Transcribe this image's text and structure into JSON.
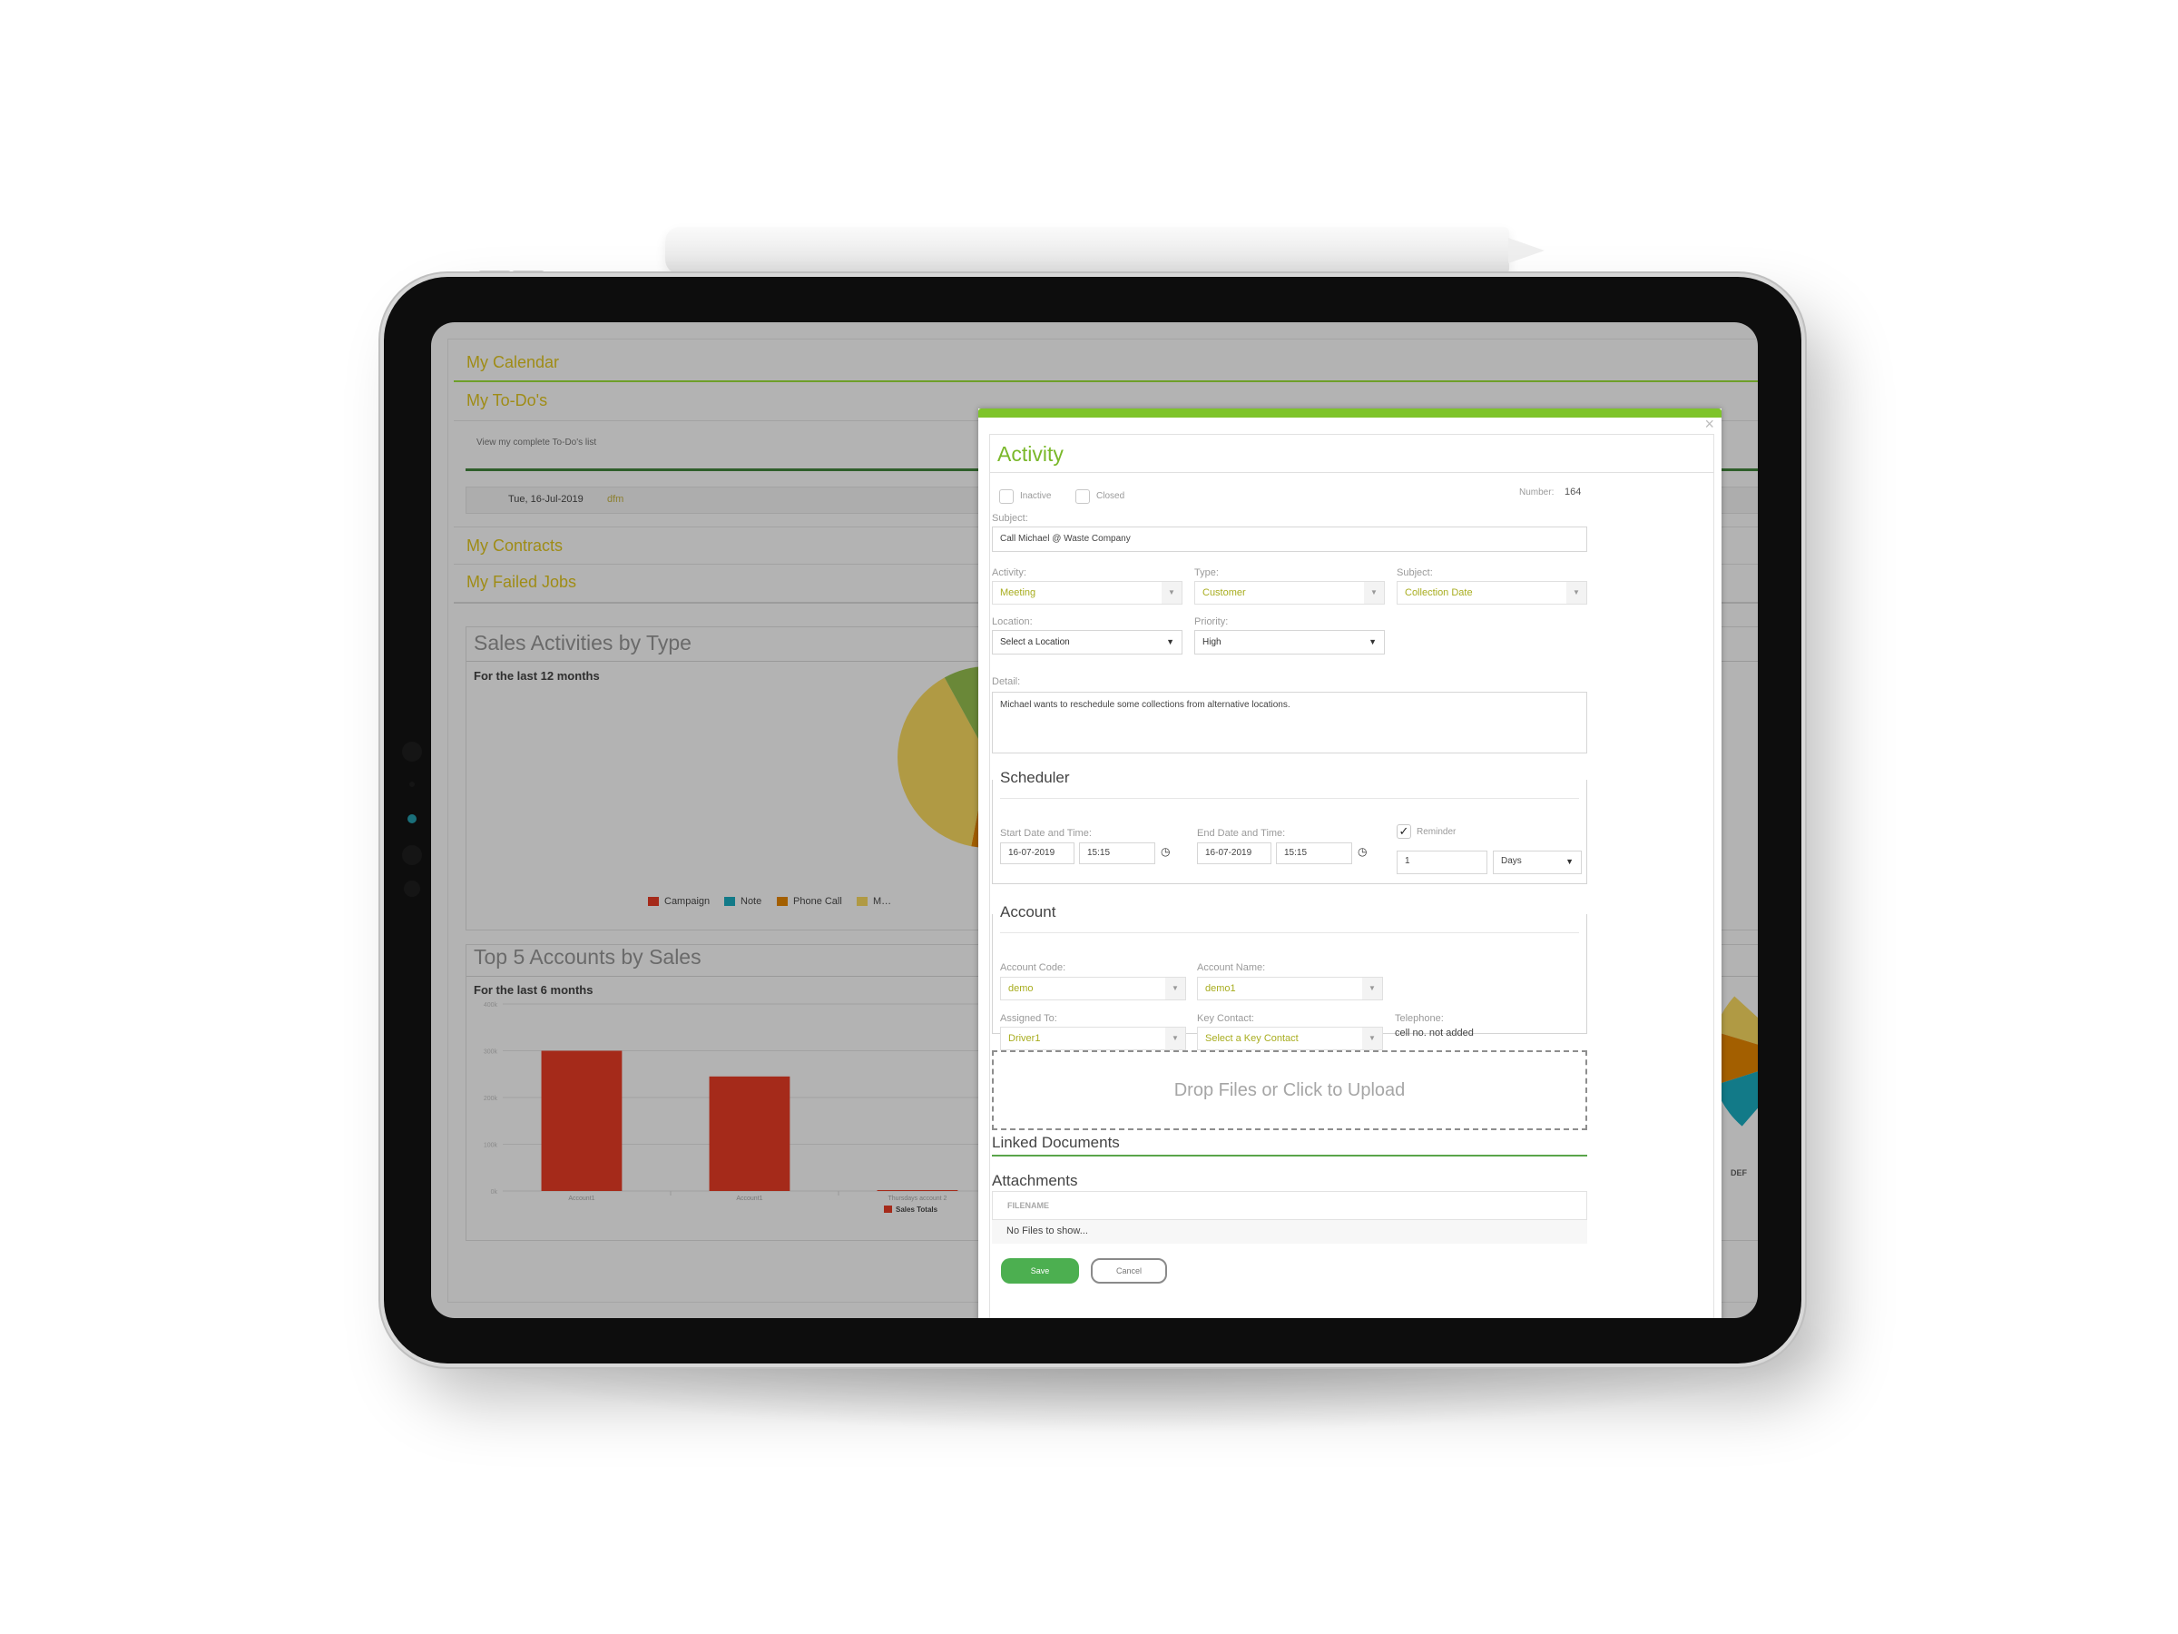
{
  "dashboard": {
    "panels": [
      {
        "title": "My Calendar"
      },
      {
        "title": "My To-Do's"
      },
      {
        "title": "My Contracts"
      },
      {
        "title": "My Failed Jobs"
      }
    ],
    "todo_link": "View my complete To-Do's list",
    "todo_row": {
      "date": "Tue, 16-Jul-2019",
      "user": "dfm"
    },
    "partial_legend_label": "DEF"
  },
  "chart_data": [
    {
      "type": "pie",
      "title": "Sales Activities by Type",
      "subtitle": "For the last 12 months",
      "slices": [
        {
          "label": "Campaign",
          "value": 16,
          "color": "#a52a1a"
        },
        {
          "label": "Note",
          "value": 3,
          "color": "#127a88"
        },
        {
          "label": "Phone Call",
          "value": 34,
          "color": "#a35f00"
        },
        {
          "label": "M…",
          "value": 39,
          "color": "#b09a44"
        },
        {
          "label": "",
          "value": 8,
          "color": "#6a8838"
        }
      ],
      "legend": [
        "Campaign",
        "Note",
        "Phone Call",
        "M…"
      ],
      "legend_position": "bottom"
    },
    {
      "type": "bar",
      "title": "Top 5 Accounts by Sales",
      "subtitle": "For the last 6 months",
      "categories": [
        "Account1",
        "Account1",
        "Thursdays account 2"
      ],
      "series": [
        {
          "name": "Sales Totals",
          "values": [
            300000,
            245000,
            2000
          ],
          "color": "#a52a1a"
        }
      ],
      "yticks": [
        "0k",
        "100k",
        "200k",
        "300k",
        "400k"
      ],
      "ylim": [
        0,
        400000
      ],
      "grid": true,
      "legend_position": "bottom-right"
    }
  ],
  "modal": {
    "title": "Activity",
    "close_icon": "×",
    "inactive_label": "Inactive",
    "closed_label": "Closed",
    "inactive_checked": false,
    "closed_checked": false,
    "number_label": "Number:",
    "number_value": "164",
    "subject_label": "Subject:",
    "subject_value": "Call Michael @ Waste Company",
    "activity_label": "Activity:",
    "activity_value": "Meeting",
    "type_label": "Type:",
    "type_value": "Customer",
    "subject2_label": "Subject:",
    "subject2_value": "Collection Date",
    "location_label": "Location:",
    "location_value": "Select a Location",
    "priority_label": "Priority:",
    "priority_value": "High",
    "detail_label": "Detail:",
    "detail_value": "Michael wants to reschedule some collections from alternative locations.",
    "scheduler": {
      "legend": "Scheduler",
      "start_label": "Start Date and Time:",
      "start_date": "16-07-2019",
      "start_time": "15:15",
      "end_label": "End Date and Time:",
      "end_date": "16-07-2019",
      "end_time": "15:15",
      "reminder_label": "Reminder",
      "reminder_checked": true,
      "reminder_value": "1",
      "reminder_unit": "Days"
    },
    "account": {
      "legend": "Account",
      "code_label": "Account Code:",
      "code_value": "demo",
      "name_label": "Account Name:",
      "name_value": "demo1",
      "assigned_label": "Assigned To:",
      "assigned_value": "Driver1",
      "contact_label": "Key Contact:",
      "contact_value": "Select a Key Contact",
      "telephone_label": "Telephone:",
      "telephone_value": "cell no. not added"
    },
    "drop_zone": "Drop Files or Click to Upload",
    "linked_documents": "Linked Documents",
    "attachments": "Attachments",
    "attachments_col": "FILENAME",
    "attachments_empty": "No Files to show...",
    "save_label": "Save",
    "cancel_label": "Cancel"
  }
}
